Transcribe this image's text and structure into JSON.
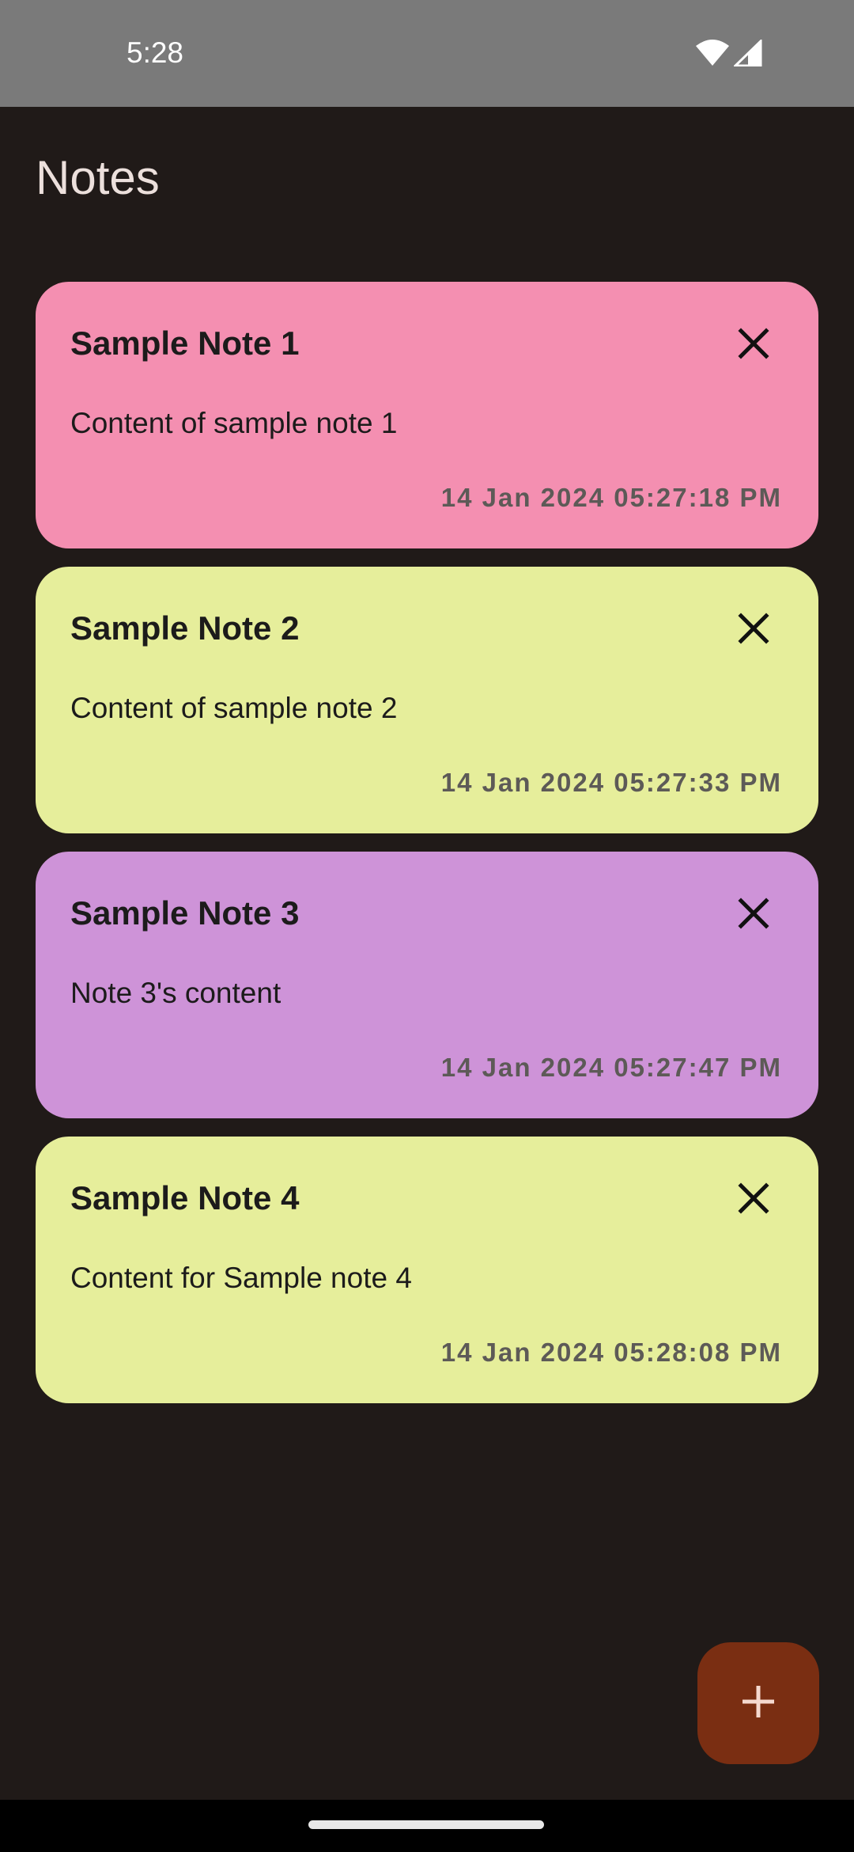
{
  "status_bar": {
    "time": "5:28",
    "icons": [
      "wifi-icon",
      "cellular-signal-icon"
    ]
  },
  "app": {
    "title": "Notes"
  },
  "notes": [
    {
      "title": "Sample Note 1",
      "content": "Content of sample note 1",
      "date": "14 Jan 2024 05:27:18 PM",
      "color": "#f48fb1",
      "close_icon": "close-icon"
    },
    {
      "title": "Sample Note 2",
      "content": "Content of sample note 2",
      "date": "14 Jan 2024 05:27:33 PM",
      "color": "#e6ee9b",
      "close_icon": "close-icon"
    },
    {
      "title": "Sample Note 3",
      "content": "Note 3's content",
      "date": "14 Jan 2024 05:27:47 PM",
      "color": "#ce93d8",
      "close_icon": "close-icon"
    },
    {
      "title": "Sample Note 4",
      "content": "Content for Sample note 4",
      "date": "14 Jan 2024 05:28:08 PM",
      "color": "#e6ee9b",
      "close_icon": "close-icon"
    }
  ],
  "fab": {
    "icon": "plus-icon",
    "color": "#7a2e12"
  },
  "theme": {
    "background": "#201a18",
    "title_color": "#ece0dc",
    "status_bar_color": "#7a7a7a"
  }
}
